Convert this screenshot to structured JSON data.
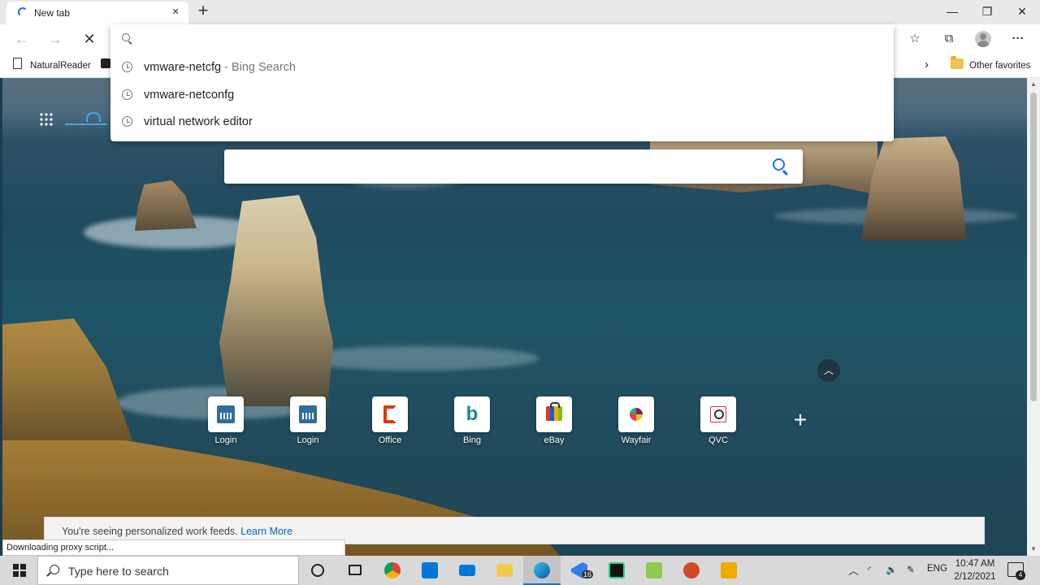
{
  "browser": {
    "tab": {
      "title": "New tab",
      "close_glyph": "×"
    },
    "new_tab_glyph": "+",
    "window_controls": {
      "minimize": "—",
      "maximize": "❐",
      "close": "✕"
    }
  },
  "toolbar": {
    "back_glyph": "←",
    "forward_glyph": "→",
    "stop_glyph": "✕",
    "favorites_glyph": "☆",
    "collections_glyph": "⧉",
    "menu_glyph": "···"
  },
  "address_bar": {
    "value": "",
    "placeholder": ""
  },
  "autocomplete": {
    "suggestions": [
      {
        "text": "vmware-netcfg",
        "suffix": " - Bing Search"
      },
      {
        "text": "vmware-netconfg",
        "suffix": ""
      },
      {
        "text": "virtual network editor",
        "suffix": ""
      }
    ]
  },
  "favorites_bar": {
    "items": [
      {
        "label": "NaturalReader"
      }
    ],
    "overflow_glyph": "›",
    "other_favorites": "Other favorites"
  },
  "newtab": {
    "search_placeholder": "",
    "quick_links": [
      {
        "label": "Login",
        "icon": "login-icon"
      },
      {
        "label": "Login",
        "icon": "login-icon"
      },
      {
        "label": "Office",
        "icon": "office-icon"
      },
      {
        "label": "Bing",
        "icon": "bing-icon"
      },
      {
        "label": "eBay",
        "icon": "ebay-icon"
      },
      {
        "label": "Wayfair",
        "icon": "wayfair-icon"
      },
      {
        "label": "QVC",
        "icon": "qvc-icon"
      }
    ],
    "bing_glyph": "b",
    "add_site_glyph": "+",
    "collapse_glyph": "︿",
    "feed_notice": {
      "text": "You're seeing personalized work feeds.",
      "link": "Learn More"
    }
  },
  "status": {
    "text": "Downloading proxy script..."
  },
  "taskbar": {
    "search_placeholder": "Type here to search",
    "apps": [
      {
        "name": "cortana-icon",
        "color": "#ffffff"
      },
      {
        "name": "task-view-icon",
        "color": "#ffffff"
      },
      {
        "name": "chrome-icon",
        "color": "#4285f4"
      },
      {
        "name": "store-icon",
        "color": "#0078d7"
      },
      {
        "name": "mail-icon",
        "color": "#0078d7"
      },
      {
        "name": "file-explorer-icon",
        "color": "#f2c94c"
      },
      {
        "name": "edge-icon",
        "color": "#1fa0e0"
      },
      {
        "name": "vscode-icon",
        "color": "#2f80ed"
      },
      {
        "name": "pycharm-icon",
        "color": "#21d789"
      },
      {
        "name": "notepadpp-icon",
        "color": "#90c94f"
      },
      {
        "name": "powerpoint-icon",
        "color": "#d24726"
      },
      {
        "name": "vmware-icon",
        "color": "#f2a900"
      }
    ],
    "vscode_badge": "16",
    "language": "ENG",
    "time": "10:47 AM",
    "date": "2/12/2021",
    "notification_count": "4"
  }
}
